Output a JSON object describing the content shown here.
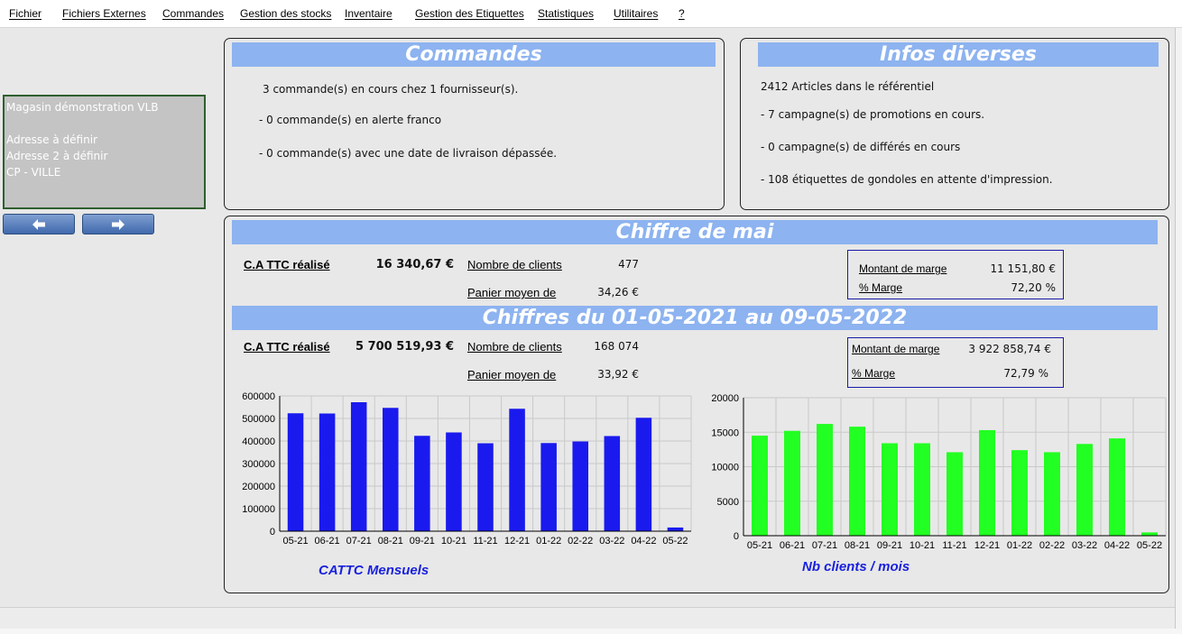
{
  "menu": [
    "Fichier",
    "Fichiers Externes",
    "Commandes",
    "Gestion des stocks",
    "Inventaire",
    "Gestion des Etiquettes",
    "Statistiques",
    "Utilitaires",
    "?"
  ],
  "shop": {
    "name": "Magasin démonstration VLB",
    "address1": "Adresse à définir",
    "address2": "Adresse 2 à définir",
    "city": "CP - VILLE"
  },
  "nav": {
    "prev_icon": "arrow-left-icon",
    "next_icon": "arrow-right-icon"
  },
  "commandes": {
    "title": "Commandes",
    "line1": "3 commande(s) en cours chez 1 fournisseur(s).",
    "line2": "-   0 commande(s) en alerte franco",
    "line3": "-   0 commande(s) avec une date de livraison dépassée."
  },
  "infos": {
    "title": "Infos diverses",
    "line1": "2412 Articles dans le référentiel",
    "line2": "-   7 campagne(s) de promotions en cours.",
    "line3": "-   0 campagne(s) de différés en cours",
    "line4": "-   108 étiquettes de gondoles en attente d'impression."
  },
  "mois": {
    "title": "Chiffre de mai",
    "ca_label": "C.A TTC réalisé",
    "ca_value": "16 340,67 €",
    "clients_label": "Nombre de clients",
    "clients_value": "477",
    "panier_label": "Panier moyen de",
    "panier_value": "34,26 €",
    "marge_label": "Montant de marge",
    "marge_value": "11 151,80 €",
    "pct_label": "% Marge",
    "pct_value": "72,20 %"
  },
  "periode": {
    "title": "Chiffres du 01-05-2021 au 09-05-2022",
    "ca_label": "C.A TTC réalisé",
    "ca_value": "5 700 519,93 €",
    "clients_label": "Nombre de clients",
    "clients_value": "168 074",
    "panier_label": "Panier moyen de",
    "panier_value": "33,92 €",
    "marge_label": "Montant de marge",
    "marge_value": "3 922 858,74 €",
    "pct_label": "% Marge",
    "pct_value": "72,79 %"
  },
  "colors": {
    "header_bar": "#8db3f0",
    "bar_ca": "#1a1aee",
    "bar_clients": "#22ff22",
    "caption": "#1a22dd"
  },
  "chart_data": [
    {
      "type": "bar",
      "title": "CATTC Mensuels",
      "categories": [
        "05-21",
        "06-21",
        "07-21",
        "08-21",
        "09-21",
        "10-21",
        "11-21",
        "12-21",
        "01-22",
        "02-22",
        "03-22",
        "04-22",
        "05-22"
      ],
      "values": [
        523000,
        522000,
        572000,
        547000,
        423000,
        438000,
        390000,
        543000,
        391000,
        398000,
        422000,
        503000,
        16341
      ],
      "ylim": [
        0,
        600000
      ],
      "yticks": [
        0,
        100000,
        200000,
        300000,
        400000,
        500000,
        600000
      ],
      "grid": true,
      "color": "#1a1aee"
    },
    {
      "type": "bar",
      "title": "Nb clients / mois",
      "categories": [
        "05-21",
        "06-21",
        "07-21",
        "08-21",
        "09-21",
        "10-21",
        "11-21",
        "12-21",
        "01-22",
        "02-22",
        "03-22",
        "04-22",
        "05-22"
      ],
      "values": [
        14500,
        15200,
        16200,
        15800,
        13400,
        13400,
        12100,
        15300,
        12400,
        12100,
        13300,
        14100,
        477
      ],
      "ylim": [
        0,
        20000
      ],
      "yticks": [
        0,
        5000,
        10000,
        15000,
        20000
      ],
      "grid": true,
      "color": "#22ff22"
    }
  ]
}
